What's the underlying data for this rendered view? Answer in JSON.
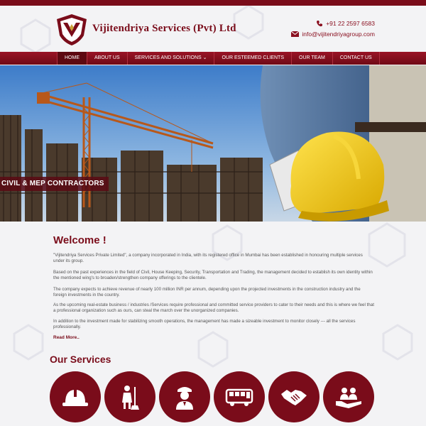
{
  "header": {
    "brand": "Vijitendriya Services (Pvt) Ltd",
    "phone": "+91 22 2597 6583",
    "email": "info@vijitendriyagroup.com",
    "logo_icon": "shield-logo-icon"
  },
  "nav": {
    "items": [
      {
        "label": "HOME",
        "active": true
      },
      {
        "label": "ABOUT US"
      },
      {
        "label": "SERVICES AND SOLUTIONS  ⌄"
      },
      {
        "label": "OUR ESTEEMED CLIENTS"
      },
      {
        "label": "OUR TEAM"
      },
      {
        "label": "CONTACT US"
      }
    ]
  },
  "hero": {
    "tagline": "CIVIL & MEP CONTRACTORS"
  },
  "welcome": {
    "title": "Welcome !",
    "paragraphs": [
      "\"Vijitendriya Services Private Limited\", a company incorporated in India, with its registered office in Mumbai has been established in honouring multiple services under its group.",
      "Based on the past experiences in the field of Civil, House Keeping, Security, Transportation and Trading, the management decided to establish its own identity within the mentioned wing's to broaden/strengthen company offerings to the clientele.",
      "The company expects to achieve revenue of nearly 100 million INR per annum, depending upon the projected investments in the construction industry and the foreign investments in the country.",
      "As the upcoming real-estate business / industries /Services require professional and committed service providers to cater to their needs and this is where we feel that a professional organization such as ours, can steal the march over the unorganized companies.",
      "In addition to the investment made for stabilizing smooth operations, the management has made a sizeable investment to monitor closely --- all the services professionally."
    ],
    "read_more": "Read More.."
  },
  "services": {
    "title": "Our Services",
    "icons": [
      "hardhat-icon",
      "housekeeping-icon",
      "security-guard-icon",
      "bus-icon",
      "handshake-icon",
      "care-hands-icon"
    ]
  },
  "colors": {
    "brand": "#7a0c1a",
    "nav_active": "#5d0811"
  }
}
